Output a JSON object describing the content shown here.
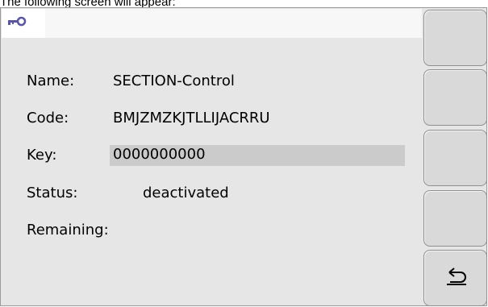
{
  "caption": "The following screen will appear:",
  "tab": {
    "icon": "key-icon"
  },
  "fields": {
    "name_label": "Name:",
    "name_value": "SECTION-Control",
    "code_label": "Code:",
    "code_value": "BMJZMZKJTLLIJACRRU",
    "key_label": "Key:",
    "key_value": "0000000000",
    "status_label": "Status:",
    "status_value": "deactivated",
    "remaining_label": "Remaining:",
    "remaining_value": ""
  },
  "softkeys": [
    {
      "icon": ""
    },
    {
      "icon": ""
    },
    {
      "icon": ""
    },
    {
      "icon": ""
    },
    {
      "icon": "return-icon"
    }
  ],
  "colors": {
    "screen_bg": "#e6e6e6",
    "key_field_bg": "#cbcbcb",
    "icon_color": "#5b55a3"
  }
}
